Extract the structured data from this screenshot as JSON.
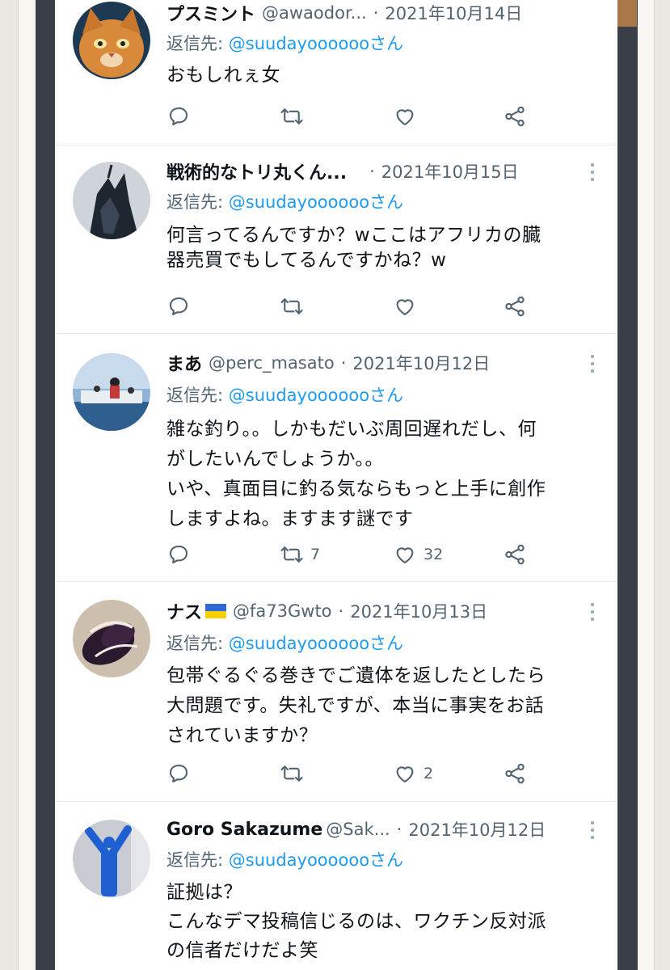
{
  "tweets": [
    {
      "name": "プスミント",
      "handle": "@awaodor...",
      "sep": "·",
      "date": "2021年10月14日",
      "reply_prefix": "返信先: ",
      "reply_mention": "@suudayoooooo",
      "reply_suffix": "さん",
      "body": "おもしれぇ女",
      "retweets": "",
      "likes": ""
    },
    {
      "name": "戦術的なトリ丸くん...",
      "handle": "",
      "sep": "·",
      "date": "2021年10月15日",
      "reply_prefix": "返信先: ",
      "reply_mention": "@suudayoooooo",
      "reply_suffix": "さん",
      "body": "何言ってるんですか？wここはアフリカの臓\n器売買でもしてるんですかね？w",
      "retweets": "",
      "likes": ""
    },
    {
      "name": "まあ",
      "handle": "@perc_masato",
      "sep": "·",
      "date": "2021年10月12日",
      "reply_prefix": "返信先: ",
      "reply_mention": "@suudayoooooo",
      "reply_suffix": "さん",
      "body": "雑な釣り。。しかもだいぶ周回遅れだし、何\nがしたいんでしょうか。。\nいや、真面目に釣る気ならもっと上手に創作\nしますよね。ますます謎です",
      "retweets": "7",
      "likes": "32"
    },
    {
      "name": "ナス",
      "handle": "@fa73Gwto",
      "sep": "·",
      "date": "2021年10月13日",
      "reply_prefix": "返信先: ",
      "reply_mention": "@suudayoooooo",
      "reply_suffix": "さん",
      "body": "包帯ぐるぐる巻きでご遺体を返したとしたら\n大問題です。失礼ですが、本当に事実をお話\nされていますか？",
      "retweets": "",
      "likes": "2"
    },
    {
      "name": "Goro Sakazume",
      "handle": "@Sak...",
      "sep": "·",
      "date": "2021年10月12日",
      "reply_prefix": "返信先: ",
      "reply_mention": "@suudayoooooo",
      "reply_suffix": "さん",
      "body": "証拠は？\nこんなデマ投稿信じるのは、ワクチン反対派\nの信者だけだよ笑",
      "retweets": "",
      "likes": ""
    }
  ],
  "icons": [
    "reply-icon",
    "retweet-icon",
    "like-icon",
    "share-icon",
    "more-icon"
  ],
  "colors": {
    "mention": "#1d9bf0",
    "secondary_text": "#536471",
    "primary_text": "#0f1419"
  }
}
